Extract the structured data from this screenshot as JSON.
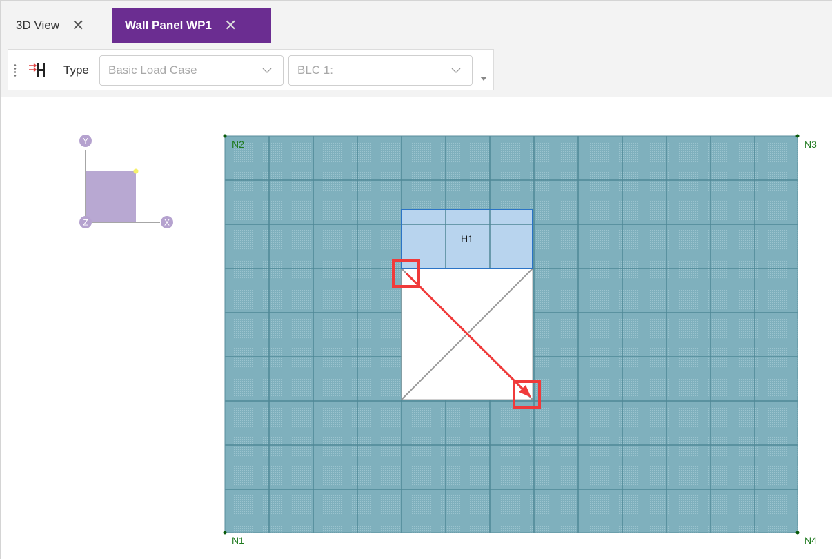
{
  "tabs": [
    {
      "label": "3D View",
      "active": false,
      "close_icon": "close-icon"
    },
    {
      "label": "Wall Panel WP1",
      "active": true,
      "close_icon": "close-icon"
    }
  ],
  "toolbar": {
    "type_icon": "load-type-icon",
    "type_label": "Type",
    "type_select_value": "Basic Load Case",
    "case_select_value": "BLC 1:"
  },
  "axes": {
    "y": "Y",
    "z": "Z",
    "x": "X"
  },
  "panel": {
    "nodes": {
      "n1": "N1",
      "n2": "N2",
      "n3": "N3",
      "n4": "N4"
    },
    "opening_label": "H1"
  },
  "colors": {
    "active_tab": "#6b2d91",
    "panel_fill": "#7fb0bd",
    "grid_line": "#4f8796",
    "opening_header": "#b8d4ee",
    "opening_border": "#2b74c6",
    "annotation": "#f03a3a",
    "node_label": "#1f7a1f",
    "axis_purple": "#b5a2cf"
  }
}
